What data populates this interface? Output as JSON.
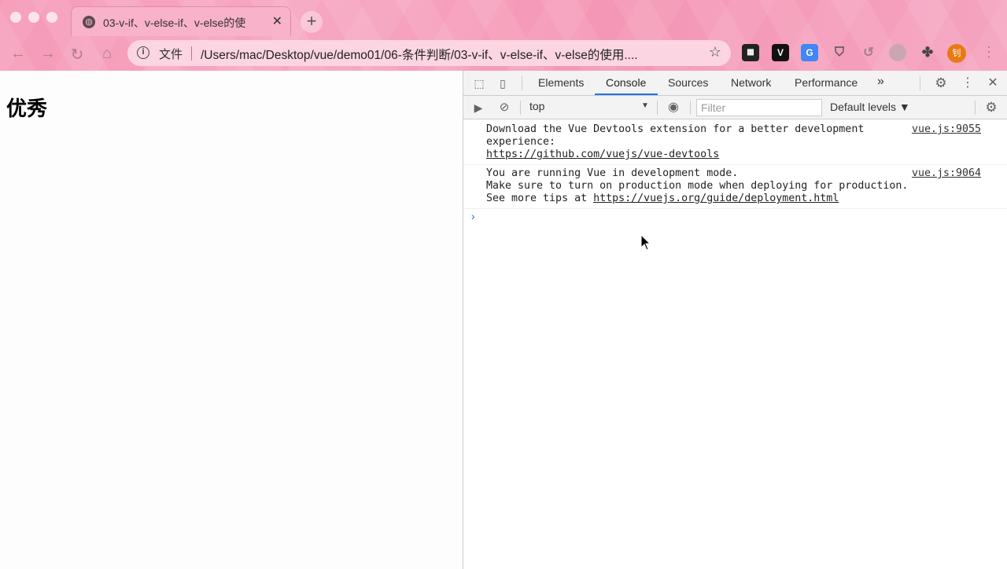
{
  "browser": {
    "tab_title": "03-v-if、v-else-if、v-else的使",
    "tab_close": "✕",
    "new_tab": "+",
    "omnibox_scheme": "文件",
    "omnibox_url": "/Users/mac/Desktop/vue/demo01/06-条件判断/03-v-if、v-else-if、v-else的使用....",
    "avatar_text": "钊"
  },
  "page": {
    "text": "优秀"
  },
  "devtools": {
    "tabs": [
      "Elements",
      "Console",
      "Sources",
      "Network",
      "Performance"
    ],
    "more_tabs": "»",
    "context": "top",
    "filter_placeholder": "Filter",
    "levels": "Default levels ▼",
    "messages": [
      {
        "lines": [
          "Download the Vue Devtools extension for a better development",
          "experience:"
        ],
        "link": "https://github.com/vuejs/vue-devtools",
        "source": "vue.js:9055"
      },
      {
        "lines": [
          "You are running Vue in development mode.",
          "Make sure to turn on production mode when deploying for production."
        ],
        "link_prefix": "See more tips at ",
        "link": "https://vuejs.org/guide/deployment.html",
        "source": "vue.js:9064"
      }
    ],
    "prompt": "›"
  },
  "colors": {
    "chrome_pink": "#f59ab8",
    "active_tab_underline": "#1a73e8",
    "avatar": "#e87a16"
  }
}
